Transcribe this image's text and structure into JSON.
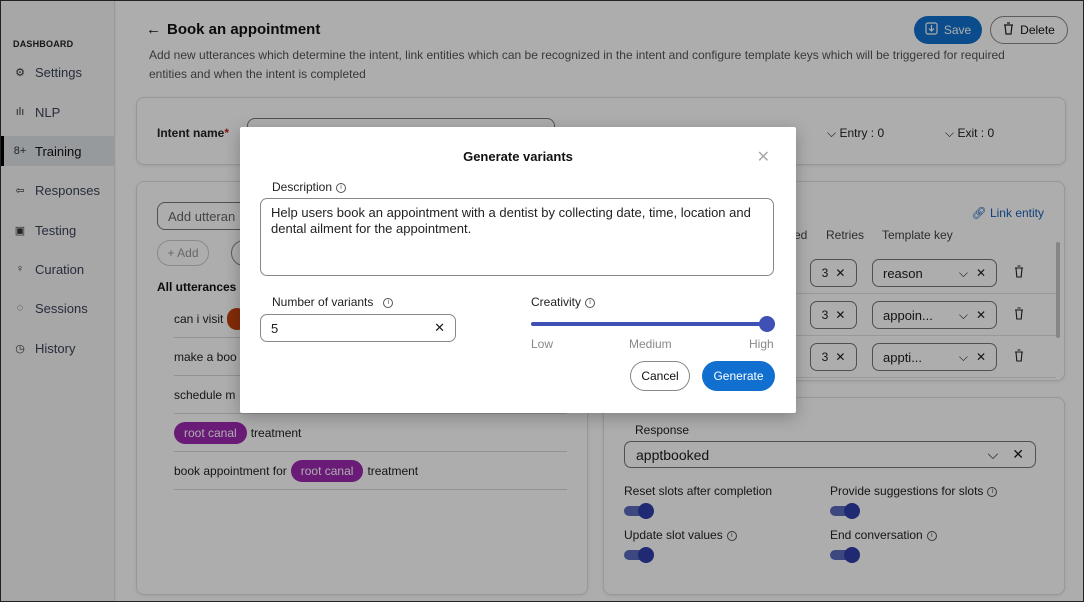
{
  "sidebar": {
    "section_title": "DASHBOARD",
    "items": [
      {
        "label": "Settings",
        "icon": "gear-icon",
        "glyph": "⚙"
      },
      {
        "label": "NLP",
        "icon": "waveform-icon",
        "glyph": "ılı"
      },
      {
        "label": "Training",
        "icon": "training-icon",
        "glyph": "8+",
        "active": true
      },
      {
        "label": "Responses",
        "icon": "responses-icon",
        "glyph": "⇦"
      },
      {
        "label": "Testing",
        "icon": "testing-icon",
        "glyph": "▣"
      },
      {
        "label": "Curation",
        "icon": "lightbulb-icon",
        "glyph": "♀"
      },
      {
        "label": "Sessions",
        "icon": "chat-icon",
        "glyph": "◌"
      },
      {
        "label": "History",
        "icon": "history-icon",
        "glyph": "◷"
      }
    ]
  },
  "header": {
    "back_glyph": "←",
    "title": "Book an appointment",
    "description": "Add new utterances which determine the intent, link entities which can be recognized in the intent and configure template keys which will be triggered for required entities and when the intent is completed",
    "save_label": "Save",
    "delete_label": "Delete"
  },
  "intent": {
    "label": "Intent name",
    "required_mark": "*",
    "entry_label": "Entry : 0",
    "exit_label": "Exit : 0"
  },
  "utterances": {
    "input_placeholder": "Add utteran",
    "add_label": "+ Add",
    "section_title": "All utterances",
    "rows": [
      {
        "parts": [
          {
            "text": "can i visit"
          },
          {
            "chip": "",
            "color": "#c2410c"
          }
        ]
      },
      {
        "parts": [
          {
            "text": "make a boo"
          }
        ]
      },
      {
        "parts": [
          {
            "text": "schedule m"
          }
        ]
      },
      {
        "parts": [
          {
            "chip": "root canal",
            "color": "#9c27b0"
          },
          {
            "text": "treatment"
          }
        ]
      },
      {
        "parts": [
          {
            "text": "book appointment for"
          },
          {
            "chip": "root canal",
            "color": "#9c27b0"
          },
          {
            "text": "treatment"
          }
        ]
      }
    ]
  },
  "entities": {
    "link_label": "Link entity",
    "col_partial": "ed",
    "col_retries": "Retries",
    "col_template_key": "Template key",
    "rows": [
      {
        "retries": "3",
        "template_key": "reason"
      },
      {
        "retries": "3",
        "template_key": "appoin..."
      },
      {
        "retries": "3",
        "template_key": "appti..."
      }
    ]
  },
  "response": {
    "label": "Response",
    "value": "apptbooked",
    "toggles": [
      {
        "label": "Reset slots after completion",
        "on": true,
        "info": false
      },
      {
        "label": "Provide suggestions for slots",
        "on": true,
        "info": true
      },
      {
        "label": "Update slot values",
        "on": true,
        "info": true
      },
      {
        "label": "End conversation",
        "on": true,
        "info": true
      }
    ]
  },
  "modal": {
    "title": "Generate variants",
    "description_label": "Description",
    "description_value": "Help users book an appointment with a dentist by collecting date, time, location and dental ailment for the appointment.",
    "variants_label": "Number of variants",
    "variants_value": "5",
    "creativity_label": "Creativity",
    "creativity_level": 1.0,
    "creativity_ticks": [
      "Low",
      "Medium",
      "High"
    ],
    "creativity_selected": "High",
    "cancel_label": "Cancel",
    "generate_label": "Generate"
  },
  "colors": {
    "primary": "#1170cf",
    "slider": "#3f51b5",
    "chip_purple": "#9c27b0",
    "chip_orange": "#c2410c",
    "link": "#1c5fb8"
  }
}
